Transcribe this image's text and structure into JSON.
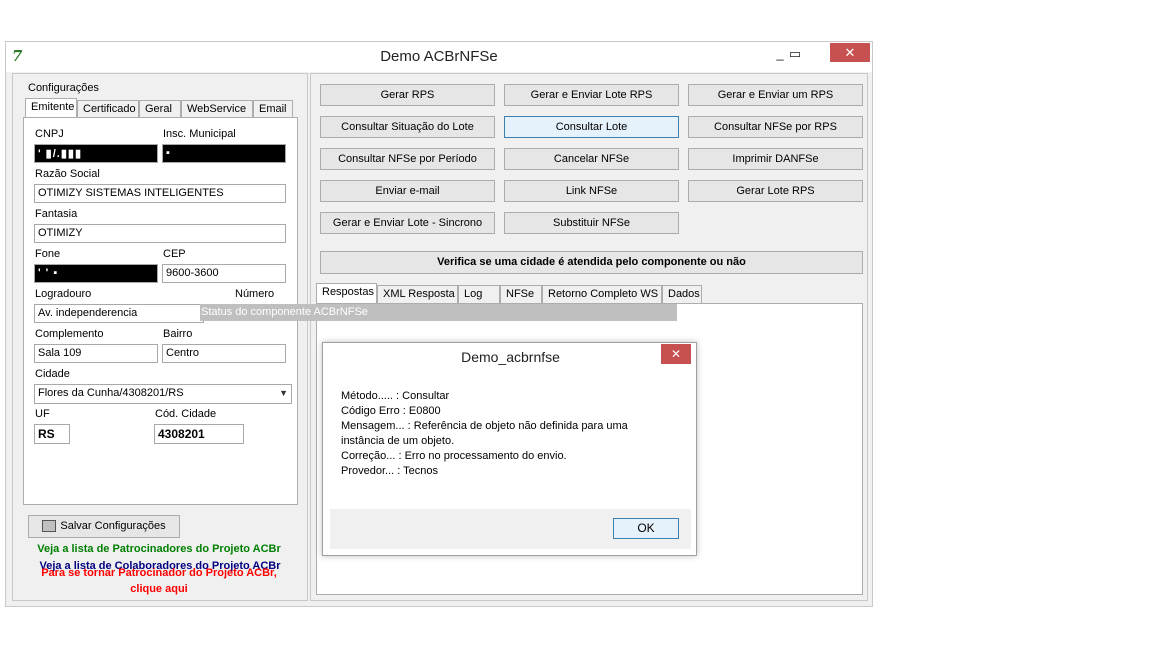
{
  "window": {
    "title": "Demo ACBrNFSe",
    "minimize": "_",
    "maximize": "▭",
    "close": "✕"
  },
  "config": {
    "group_label": "Configurações",
    "tabs": [
      "Emitente",
      "Certificado",
      "Geral",
      "WebService",
      "Email"
    ],
    "fields": {
      "cnpj_label": "CNPJ",
      "cnpj_value": "  ' ▮/.▮▮▮",
      "im_label": "Insc. Municipal",
      "im_value": "  ▪",
      "razao_label": "Razão Social",
      "razao_value": "OTIMIZY SISTEMAS INTELIGENTES",
      "fantasia_label": "Fantasia",
      "fantasia_value": "OTIMIZY",
      "fone_label": "Fone",
      "fone_value": "  '  ' ▪",
      "cep_label": "CEP",
      "cep_value": "9600-3600",
      "logradouro_label": "Logradouro",
      "logradouro_value": "Av. independerencia",
      "numero_label": "Número",
      "complemento_label": "Complemento",
      "complemento_value": "Sala 109",
      "bairro_label": "Bairro",
      "bairro_value": "Centro",
      "cidade_label": "Cidade",
      "cidade_value": "Flores da Cunha/4308201/RS",
      "uf_label": "UF",
      "uf_value": "RS",
      "codcidade_label": "Cód. Cidade",
      "codcidade_value": "4308201"
    },
    "save_button": "Salvar Configurações"
  },
  "links": {
    "colaboradores": "Veja a lista de Colaboradores do Projeto ACBr",
    "patrocinadores": "Veja a lista de Patrocinadores do Projeto ACBr",
    "tornar_1": "Para se tornar Patrocinador do Projeto ACBr,",
    "tornar_2": "clique aqui",
    "colors": {
      "colaboradores": "#000080",
      "patrocinadores": "#008000",
      "tornar": "#ff0000"
    }
  },
  "actions": {
    "buttons": [
      "Gerar RPS",
      "Gerar e Enviar Lote RPS",
      "Gerar e Enviar um RPS",
      "Consultar Situação do Lote",
      "Consultar Lote",
      "Consultar NFSe por RPS",
      "Consultar NFSe por Período",
      "Cancelar NFSe",
      "Imprimir DANFSe",
      "Enviar e-mail",
      "Link NFSe",
      "Gerar Lote RPS",
      "Gerar e Enviar Lote - Sincrono",
      "Substituir NFSe"
    ],
    "verify_button": "Verifica se uma cidade é atendida pelo componente ou não"
  },
  "result_tabs": [
    "Respostas",
    "XML Resposta",
    "Log",
    "NFSe",
    "Retorno Completo WS",
    "Dados"
  ],
  "status_text": "Status do componente ACBrNFSe",
  "dialog": {
    "title": "Demo_acbrnfse",
    "close": "✕",
    "lines": [
      "Método..... : Consultar",
      "Código Erro : E0800",
      "Mensagem... : Referência de objeto não definida para uma",
      "instância de um objeto.",
      "Correção... : Erro no processamento do envio.",
      "Provedor... : Tecnos"
    ],
    "ok": "OK"
  },
  "icons": {
    "app": "acbr-logo-icon",
    "save": "save-config-icon",
    "dropdown": "chevron-down-icon"
  }
}
